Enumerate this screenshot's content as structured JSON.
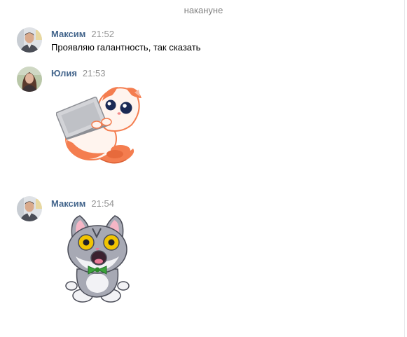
{
  "divider": {
    "label": "накануне"
  },
  "messages": [
    {
      "author": "Максим",
      "time": "21:52",
      "text": "Проявляю галантность, так сказать"
    },
    {
      "author": "Юлия",
      "time": "21:53",
      "sticker": "cat-with-laptop-sticker"
    },
    {
      "author": "Максим",
      "time": "21:54",
      "sticker": "surprised-gray-cat-sticker"
    }
  ],
  "colors": {
    "author": "#42648b",
    "time": "#939393",
    "divider_text": "#828282",
    "orange_cat": "#f47d4f",
    "gray_cat": "#a7a9b4",
    "bow_tie": "#3ca33a"
  }
}
